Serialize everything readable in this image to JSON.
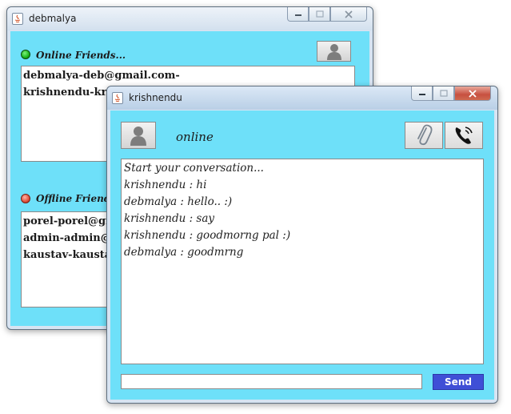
{
  "back_window": {
    "title": "debmalya",
    "online_label": "Online Friends...",
    "offline_label": "Offline Friends",
    "online_items": [
      "debmalya-deb@gmail.com-",
      "krishnendu-krishnendu@gmail.com-"
    ],
    "offline_items": [
      "porel-porel@gmail.com-",
      "admin-admin@gmail.com-",
      "kaustav-kaustav@gmail.com-"
    ],
    "online_color": "#19b51b",
    "offline_color": "#e0513c"
  },
  "chat_window": {
    "title": "krishnendu",
    "status": "online",
    "messages": [
      "Start your conversation...",
      "krishnendu : hi",
      "debmalya : hello.. :)",
      "krishnendu : say",
      "krishnendu : goodmorng pal :)",
      "debmalya : goodmrng"
    ],
    "message_input": "",
    "send_label": "Send",
    "send_color": "#3f4fd6",
    "icons": [
      "avatar-icon",
      "paperclip-icon",
      "phone-icon"
    ]
  },
  "theme": {
    "panel_bg": "#6ee0f9"
  }
}
